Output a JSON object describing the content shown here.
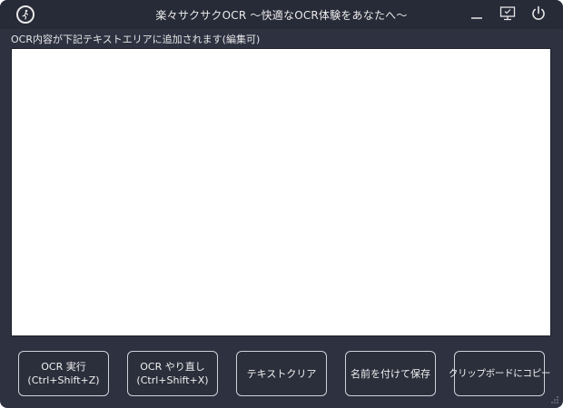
{
  "window": {
    "title": "楽々サクサクOCR 〜快適なOCR体験をあなたへ〜",
    "icons": {
      "app": "running-person-icon",
      "minimize": "minimize-icon",
      "monitor": "monitor-check-icon",
      "power": "power-icon"
    }
  },
  "main": {
    "instruction": "OCR内容が下記テキストエリアに追加されます(編集可)",
    "textarea_value": ""
  },
  "buttons": {
    "ocr_run": {
      "line1": "OCR 実行",
      "line2": "(Ctrl+Shift+Z)"
    },
    "ocr_redo": {
      "line1": "OCR やり直し",
      "line2": "(Ctrl+Shift+X)"
    },
    "clear": "テキストクリア",
    "save_as": "名前を付けて保存",
    "copy_clipboard": "クリップボードにコピー"
  },
  "colors": {
    "window_bg": "#2e3140",
    "titlebar_bg": "#272a37",
    "button_border": "#cfd1d8",
    "text": "#f0f0f0"
  }
}
